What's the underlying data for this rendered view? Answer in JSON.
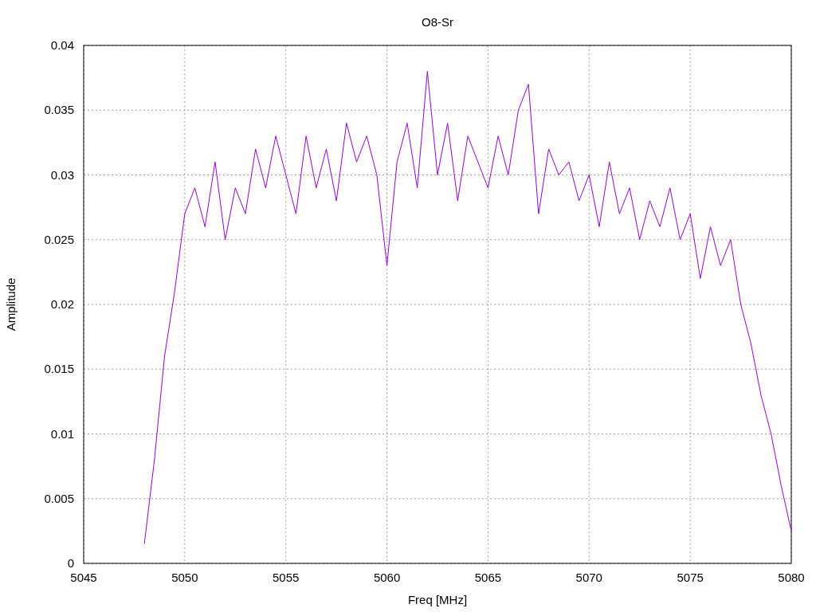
{
  "chart_data": {
    "type": "line",
    "title": "O8-Sr",
    "xlabel": "Freq [MHz]",
    "ylabel": "Amplitude",
    "grid": true,
    "xlim": [
      5045,
      5080
    ],
    "ylim": [
      0,
      0.04
    ],
    "xticks": [
      5045,
      5050,
      5055,
      5060,
      5065,
      5070,
      5075,
      5080
    ],
    "yticks": [
      0,
      0.005,
      0.01,
      0.015,
      0.02,
      0.025,
      0.03,
      0.035,
      0.04
    ],
    "x": [
      5048,
      5048.5,
      5049,
      5049.5,
      5050,
      5050.5,
      5051,
      5051.5,
      5052,
      5052.5,
      5053,
      5053.5,
      5054,
      5054.5,
      5055,
      5055.5,
      5056,
      5056.5,
      5057,
      5057.5,
      5058,
      5058.5,
      5059,
      5059.5,
      5060,
      5060.5,
      5061,
      5061.5,
      5062,
      5062.5,
      5063,
      5063.5,
      5064,
      5064.5,
      5065,
      5065.5,
      5066,
      5066.5,
      5067,
      5067.5,
      5068,
      5068.5,
      5069,
      5069.5,
      5070,
      5070.5,
      5071,
      5071.5,
      5072,
      5072.5,
      5073,
      5073.5,
      5074,
      5074.5,
      5075,
      5075.5,
      5076,
      5076.5,
      5077,
      5077.5,
      5078,
      5078.5,
      5079,
      5079.5,
      5080
    ],
    "series": [
      {
        "color": "#9400d3",
        "values": [
          0.0015,
          0.008,
          0.016,
          0.021,
          0.027,
          0.029,
          0.026,
          0.031,
          0.025,
          0.029,
          0.027,
          0.032,
          0.029,
          0.033,
          0.03,
          0.027,
          0.033,
          0.029,
          0.032,
          0.028,
          0.034,
          0.031,
          0.033,
          0.03,
          0.023,
          0.031,
          0.034,
          0.029,
          0.038,
          0.03,
          0.034,
          0.028,
          0.033,
          0.031,
          0.029,
          0.033,
          0.03,
          0.035,
          0.037,
          0.027,
          0.032,
          0.03,
          0.031,
          0.028,
          0.03,
          0.026,
          0.031,
          0.027,
          0.029,
          0.025,
          0.028,
          0.026,
          0.029,
          0.025,
          0.027,
          0.022,
          0.026,
          0.023,
          0.025,
          0.02,
          0.017,
          0.013,
          0.01,
          0.006,
          0.0025
        ]
      }
    ]
  }
}
